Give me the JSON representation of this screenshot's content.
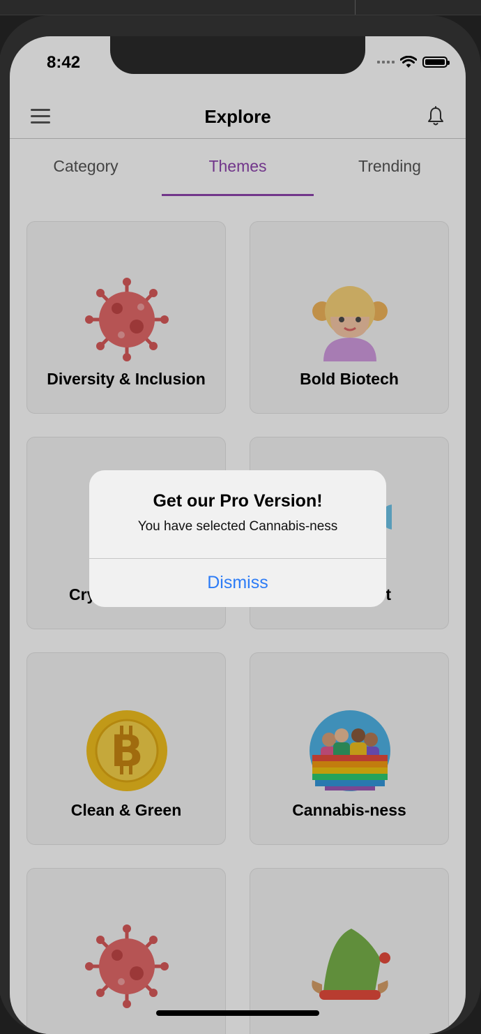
{
  "status_bar": {
    "time": "8:42"
  },
  "header": {
    "title": "Explore",
    "menu_icon": "hamburger-menu-icon",
    "bell_icon": "bell-icon"
  },
  "tabs": [
    {
      "label": "Category",
      "active": false
    },
    {
      "label": "Themes",
      "active": true
    },
    {
      "label": "Trending",
      "active": false
    }
  ],
  "theme_cards": [
    {
      "label": "Diversity & Inclusion",
      "icon": "virus-icon"
    },
    {
      "label": "Bold Biotech",
      "icon": "girl-avatar-icon"
    },
    {
      "label": "Cry",
      "icon": "crypto-icon"
    },
    {
      "label": "t",
      "icon": "globe-icon"
    },
    {
      "label": "Clean & Green",
      "icon": "bitcoin-icon"
    },
    {
      "label": "Cannabis-ness",
      "icon": "diverse-group-icon"
    },
    {
      "label": "",
      "icon": "virus-icon"
    },
    {
      "label": "",
      "icon": "elf-hat-icon"
    }
  ],
  "alert": {
    "title": "Get our Pro Version!",
    "message": "You have selected Cannabis-ness",
    "dismiss_label": "Dismiss"
  },
  "colors": {
    "accent": "#8e44ad",
    "alert_button": "#2d7cf6"
  }
}
